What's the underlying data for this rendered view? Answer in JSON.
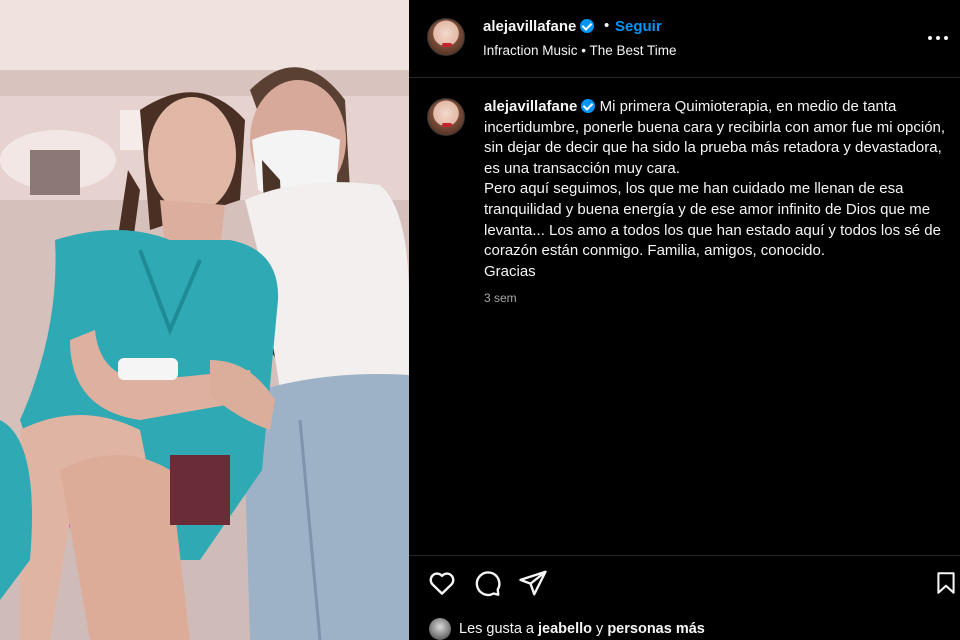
{
  "post": {
    "username": "alejavillafane",
    "separator": "•",
    "follow_label": "Seguir",
    "audio": "Infraction Music • The Best Time"
  },
  "caption": {
    "username": "alejavillafane",
    "lines": [
      "Mi primera Quimioterapia, en medio de tanta incertidumbre, ponerle buena cara y recibirla con amor fue mi opción, sin dejar de decir que ha sido la prueba más retadora y devastadora, es una transacción muy cara.",
      "Pero aquí seguimos, los que me han cuidado me llenan de esa tranquilidad y buena energía y de ese amor infinito de Dios que me levanta... Los amo a todos los que han estado aquí y todos los sé de corazón están conmigo. Familia, amigos, conocido.",
      "Gracias"
    ],
    "time": "3 sem"
  },
  "likes": {
    "prefix": "Les gusta a",
    "user": "jeabello",
    "conj": "y",
    "others": "personas más"
  },
  "icons": {
    "like": "heart-icon",
    "comment": "comment-icon",
    "share": "send-icon",
    "save": "bookmark-icon",
    "more": "more-options-icon"
  },
  "colors": {
    "background": "#000000",
    "accent": "#0095f6",
    "text": "#f5f5f5",
    "muted": "#a8a8a8"
  }
}
